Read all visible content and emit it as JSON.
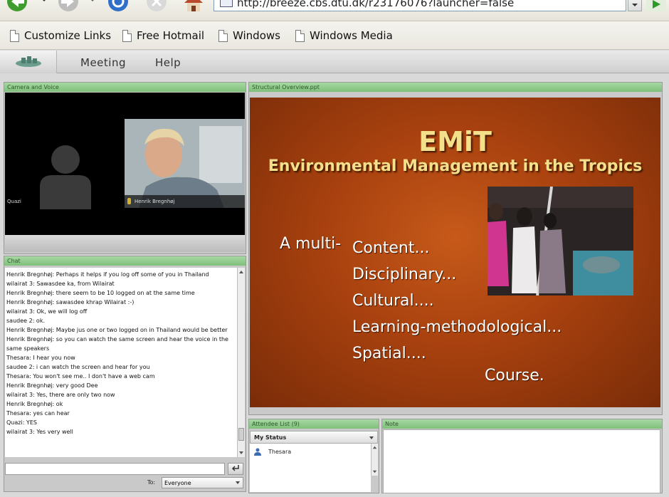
{
  "browser": {
    "address_url": "http://breeze.cbs.dtu.dk/r23176076?launcher=false"
  },
  "links_bar": {
    "items": [
      "Customize Links",
      "Free Hotmail",
      "Windows",
      "Windows Media"
    ]
  },
  "app_menu": {
    "items": [
      "Meeting",
      "Help"
    ]
  },
  "pods": {
    "camera": {
      "title": "Camera and Voice",
      "participants": [
        {
          "name": "Quazi"
        },
        {
          "name": "Henrik Bregnhøj"
        }
      ]
    },
    "share": {
      "title": "Structural Overview.ppt"
    },
    "chat": {
      "title": "Chat",
      "to_label": "To:",
      "to_value": "Everyone",
      "messages": [
        "Henrik Bregnhøj: Perhaps it helps if you log off some of you in Thailand",
        "wilairat 3: Sawasdee ka, from Wilairat",
        "Henrik Bregnhøj: there seem to be 10 logged on at the same time",
        "Henrik Bregnhøj: sawasdee khrap Wilairat :-)",
        "wilairat 3: Ok, we will log off",
        "saudee 2: ok.",
        "Henrik Bregnhøj: Maybe jus one or two logged on in Thailand would be better",
        "Henrik Bregnhøj: so you can watch the same screen and hear the voice in the same speakers",
        "Thesara: I hear you now",
        "saudee 2: i can watch the screen and hear for you",
        "Thesara: You won't see me.. I don't have a web cam",
        "Henrik Bregnhøj: very good Dee",
        "wilairat 3: Yes, there are only two now",
        "Henrik Bregnhøj: ok",
        "Thesara: yes can hear",
        "Quazi: YES",
        "wilairat 3: Yes very well"
      ]
    },
    "attendees": {
      "title": "Attendee List (9)",
      "status_label": "My Status",
      "list": [
        "Thesara"
      ]
    },
    "note": {
      "title": "Note"
    }
  },
  "slide": {
    "title": "EMiT",
    "subtitle": "Environmental Management in the Tropics",
    "lead": "A multi-",
    "bullets": [
      "Content...",
      "Disciplinary...",
      "Cultural....",
      "Learning-methodological...",
      "Spatial...."
    ],
    "closing": "Course."
  },
  "colors": {
    "pod_header": "#8fca8a",
    "slide_background": "#a8410f",
    "slide_title": "#f4e08a",
    "camera_background": "#000000"
  }
}
